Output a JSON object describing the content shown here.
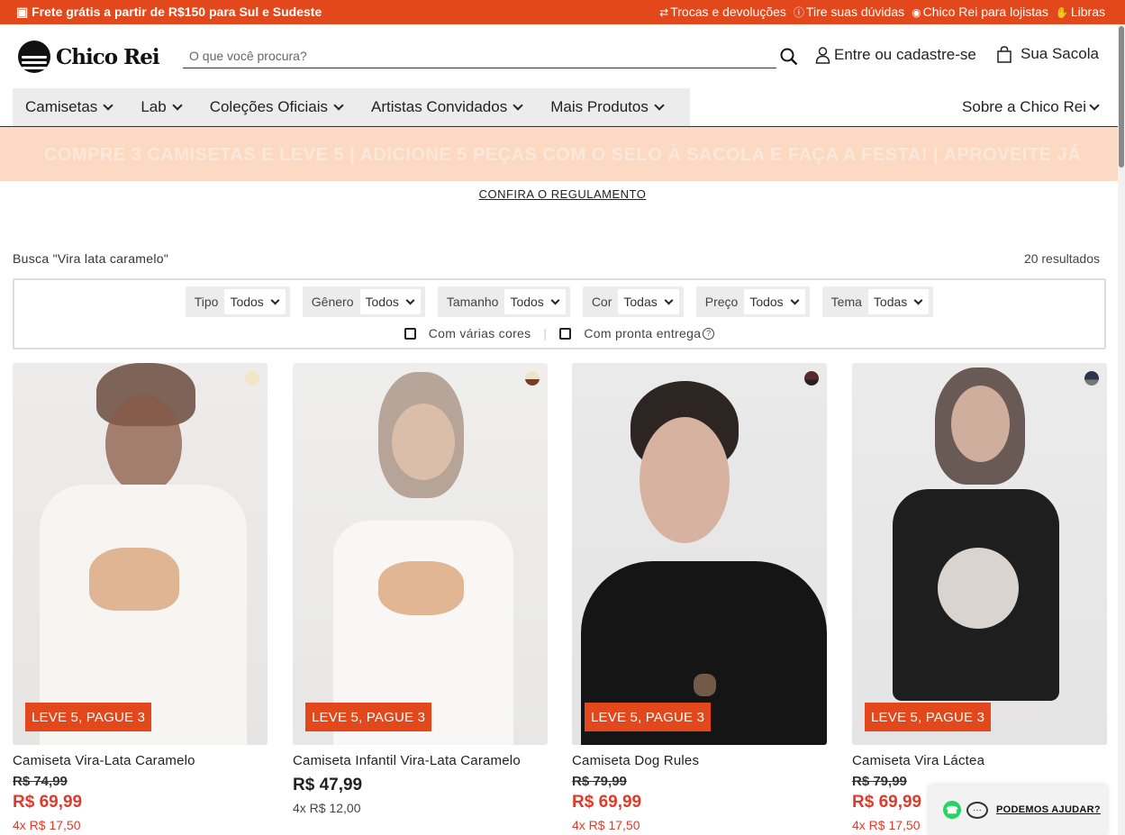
{
  "topbar": {
    "promo": "Frete grátis a partir de R$150 para Sul e Sudeste",
    "links": [
      {
        "icon": "exchange-icon",
        "label": "Trocas e devoluções"
      },
      {
        "icon": "question-icon",
        "label": "Tire suas dúvidas"
      },
      {
        "icon": "store-icon",
        "label": "Chico Rei para lojistas"
      },
      {
        "icon": "hand-icon",
        "label": "Libras"
      }
    ]
  },
  "header": {
    "logo": "Chico Rei",
    "search_placeholder": "O que você procura?",
    "account_label": "Entre ou cadastre-se",
    "bag_label": "Sua Sacola"
  },
  "nav": {
    "items": [
      "Camisetas",
      "Lab",
      "Coleções Oficiais",
      "Artistas Convidados",
      "Mais Produtos"
    ],
    "right": "Sobre a Chico Rei"
  },
  "banner": {
    "text": "COMPRE 3 CAMISETAS E LEVE 5 | ADICIONE 5 PEÇAS COM O SELO À SACOLA E FAÇA A FESTA! | APROVEITE JÁ",
    "link": "CONFIRA O REGULAMENTO"
  },
  "search_info": {
    "query": "Busca \"Vira lata caramelo\"",
    "results": "20 resultados"
  },
  "filters": {
    "selects": [
      {
        "label": "Tipo",
        "value": "Todos"
      },
      {
        "label": "Gênero",
        "value": "Todos"
      },
      {
        "label": "Tamanho",
        "value": "Todos"
      },
      {
        "label": "Cor",
        "value": "Todas"
      },
      {
        "label": "Preço",
        "value": "Todos"
      },
      {
        "label": "Tema",
        "value": "Todas"
      }
    ],
    "checkboxes": [
      "Com várias cores",
      "Com pronta entrega"
    ]
  },
  "products": [
    {
      "name": "Camiseta Vira-Lata Caramelo",
      "old_price": "R$ 74,99",
      "price": "R$ 69,99",
      "installment": "4x R$ 17,50",
      "badge": "LEVE 5, PAGUE 3",
      "swatch": "#f3e6c4"
    },
    {
      "name": "Camiseta Infantil Vira-Lata Caramelo",
      "old_price": "",
      "price": "R$ 47,99",
      "installment": "4x R$ 12,00",
      "badge": "LEVE 5, PAGUE 3",
      "swatch": "#efe3c8"
    },
    {
      "name": "Camiseta Dog Rules",
      "old_price": "R$ 79,99",
      "price": "R$ 69,99",
      "installment": "4x R$ 17,50",
      "badge": "LEVE 5, PAGUE 3",
      "swatch": "#5a2a2a"
    },
    {
      "name": "Camiseta Vira Láctea",
      "old_price": "R$ 79,99",
      "price": "R$ 69,99",
      "installment": "4x R$ 17,50",
      "badge": "LEVE 5, PAGUE 3",
      "swatch": "#2c3550"
    }
  ],
  "chat": {
    "label": "PODEMOS AJUDAR?"
  },
  "colors": {
    "accent": "#e2481c",
    "price_red": "#e23a2a",
    "banner_bg": "#fbd9c2"
  }
}
